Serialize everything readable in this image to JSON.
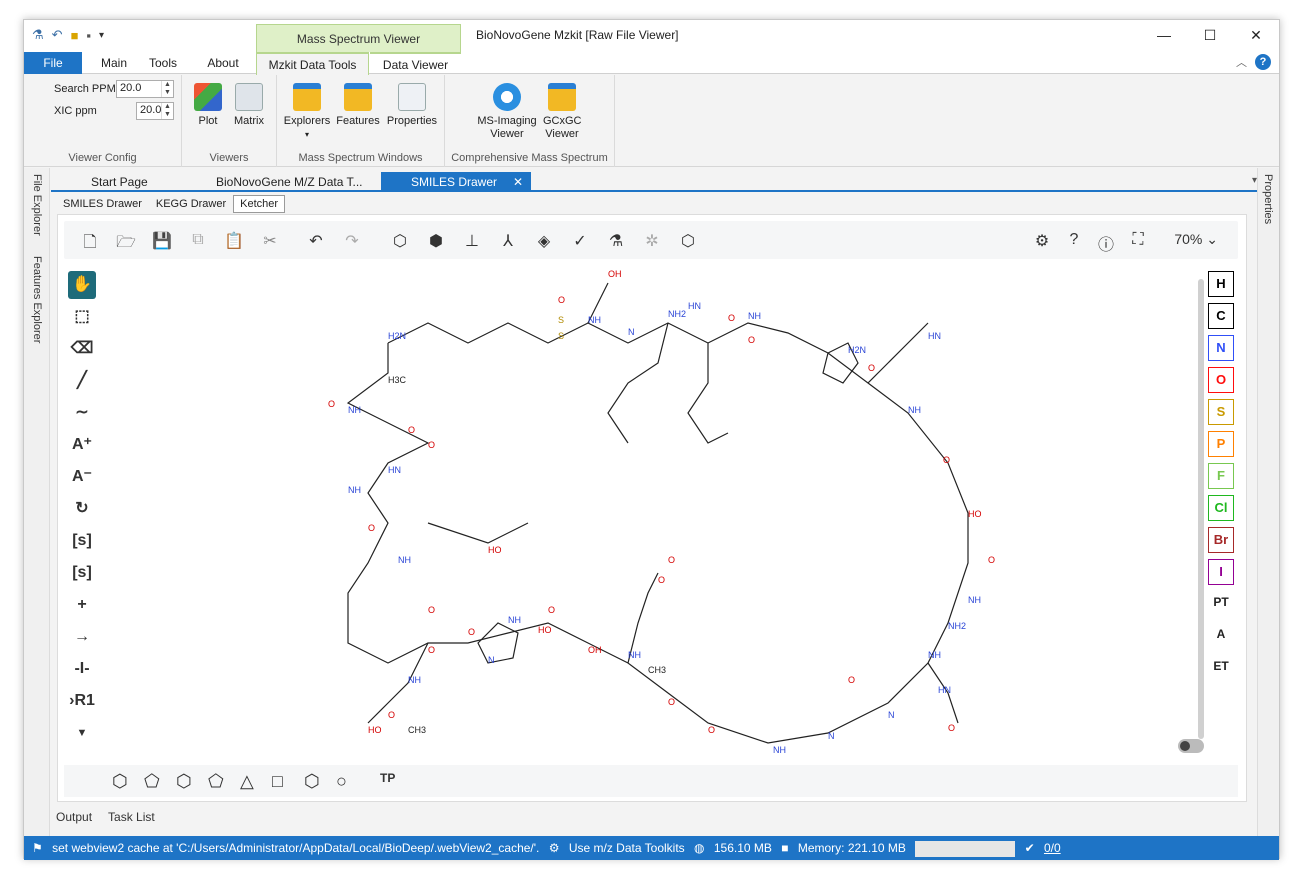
{
  "window": {
    "title": "BioNovoGene Mzkit [Raw File Viewer]",
    "context_tab_header": "Mass Spectrum Viewer"
  },
  "ribbon_tabs": [
    "File",
    "Main",
    "Tools",
    "About",
    "Mzkit Data Tools",
    "Data Viewer"
  ],
  "viewer_config": {
    "search_ppm_label": "Search PPM",
    "search_ppm_value": "20.0",
    "xic_ppm_label": "XIC ppm",
    "xic_ppm_value": "20.0",
    "group_label": "Viewer Config"
  },
  "viewers": {
    "buttons": [
      "Plot",
      "Matrix"
    ],
    "group_label": "Viewers"
  },
  "ms_windows": {
    "buttons": [
      "Explorers",
      "Features",
      "Properties"
    ],
    "group_label": "Mass Spectrum Windows"
  },
  "comprehensive": {
    "buttons": [
      "MS-Imaging Viewer",
      "GCxGC Viewer"
    ],
    "group_label": "Comprehensive Mass Spectrum"
  },
  "side_panels": {
    "left_1": "File Explorer",
    "left_2": "Features Explorer",
    "right": "Properties"
  },
  "doc_tabs": [
    "Start Page",
    "BioNovoGene M/Z Data T...",
    "SMILES Drawer"
  ],
  "sub_tabs": [
    "SMILES Drawer",
    "KEGG Drawer",
    "Ketcher"
  ],
  "ketcher": {
    "zoom": "70%",
    "atoms": [
      "H",
      "C",
      "N",
      "O",
      "S",
      "P",
      "F",
      "Cl",
      "Br",
      "I",
      "PT",
      "A",
      "ET"
    ],
    "atom_colors": {
      "H": "#000000",
      "C": "#000000",
      "N": "#304ff7",
      "O": "#ff0d0d",
      "S": "#c99a00",
      "P": "#ff8000",
      "F": "#78c850",
      "Cl": "#1fb81f",
      "Br": "#a62929",
      "I": "#940094"
    },
    "left_tools": [
      "hand",
      "select",
      "erase",
      "bond",
      "chain",
      "charge-plus",
      "charge-minus",
      "rotate",
      "sgroup",
      "sgroup-plus",
      "plus",
      "arrow",
      "bracket",
      "rgroup"
    ],
    "shape_tools": [
      "benzene",
      "cyclopentadiene",
      "cyclohexane",
      "cyclopentane",
      "cyclopropane",
      "cyclobutane",
      "cycloheptane",
      "cyclooctane",
      "TP"
    ],
    "template_label": "TP",
    "molecule_labels": [
      "OH",
      "O",
      "H2N",
      "S",
      "S",
      "NH",
      "N",
      "NH2",
      "HN",
      "O",
      "NH",
      "O",
      "H2N",
      "O",
      "NH",
      "HN",
      "O",
      "HO",
      "O",
      "NH",
      "NH2",
      "NH",
      "HN",
      "O",
      "N",
      "O",
      "N",
      "NH",
      "O",
      "O",
      "CH3",
      "NH",
      "O",
      "O",
      "OH",
      "O",
      "HO",
      "NH",
      "O",
      "N",
      "O",
      "NH",
      "HO",
      "O",
      "CH3",
      "O",
      "NH",
      "O",
      "NH",
      "HN",
      "NH",
      "O",
      "H3C",
      "O",
      "O",
      "HO"
    ]
  },
  "bottom_tabs": [
    "Output",
    "Task List"
  ],
  "status": {
    "message": "set webview2 cache at 'C:/Users/Administrator/AppData/Local/BioDeep/.webView2_cache/'.",
    "toolkit": "Use m/z Data Toolkits",
    "mem1": "156.10 MB",
    "mem2": "Memory: 221.10 MB",
    "tasks": "0/0"
  }
}
